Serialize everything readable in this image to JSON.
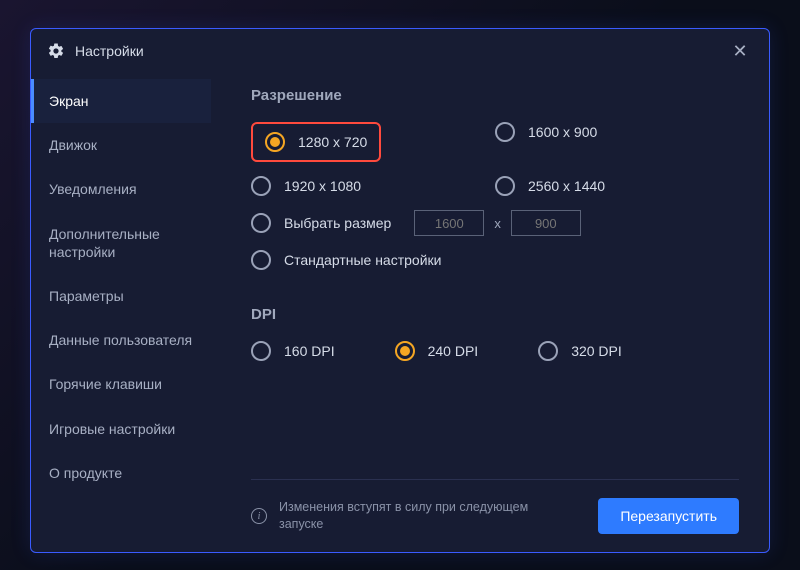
{
  "dialog": {
    "title": "Настройки"
  },
  "sidebar": {
    "items": [
      {
        "label": "Экран",
        "active": true
      },
      {
        "label": "Движок",
        "active": false
      },
      {
        "label": "Уведомления",
        "active": false
      },
      {
        "label": "Дополнительные настройки",
        "active": false
      },
      {
        "label": "Параметры",
        "active": false
      },
      {
        "label": "Данные пользователя",
        "active": false
      },
      {
        "label": "Горячие клавиши",
        "active": false
      },
      {
        "label": "Игровые настройки",
        "active": false
      },
      {
        "label": "О продукте",
        "active": false
      }
    ]
  },
  "resolution": {
    "heading": "Разрешение",
    "options": [
      {
        "label": "1280 x 720",
        "selected": true,
        "highlighted": true
      },
      {
        "label": "1600 x 900",
        "selected": false
      },
      {
        "label": "1920 x 1080",
        "selected": false
      },
      {
        "label": "2560 x 1440",
        "selected": false
      }
    ],
    "custom": {
      "label": "Выбрать размер",
      "width_placeholder": "1600",
      "height_placeholder": "900",
      "separator": "x"
    },
    "default_option": {
      "label": "Стандартные настройки",
      "selected": false
    }
  },
  "dpi": {
    "heading": "DPI",
    "options": [
      {
        "label": "160 DPI",
        "selected": false
      },
      {
        "label": "240 DPI",
        "selected": true
      },
      {
        "label": "320 DPI",
        "selected": false
      }
    ]
  },
  "footer": {
    "message": "Изменения вступят в силу при следующем запуске",
    "restart_label": "Перезапустить"
  }
}
